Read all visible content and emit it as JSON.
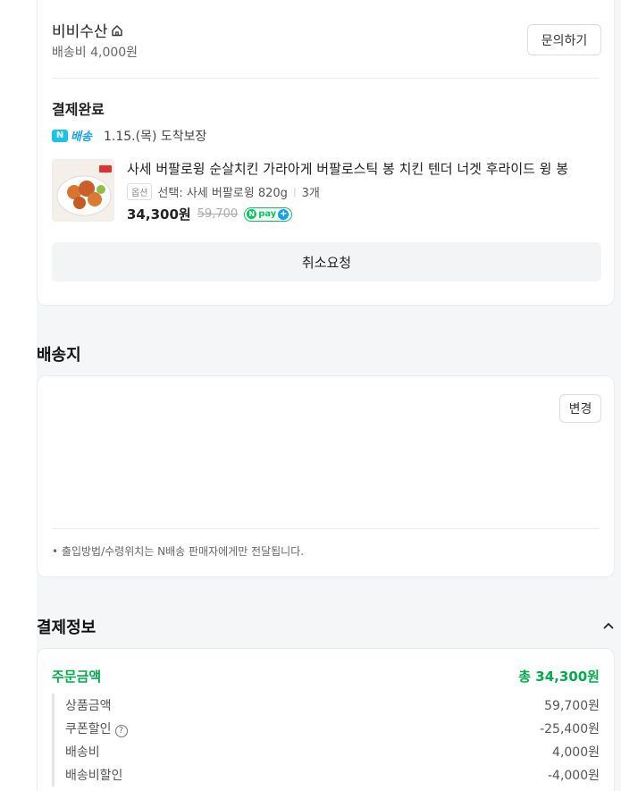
{
  "store": {
    "name": "비비수산",
    "shipping_fee": "배송비 4,000원",
    "inquiry_label": "문의하기"
  },
  "order": {
    "status": "결제완료",
    "delivery_badge": "배송",
    "delivery_badge_n": "N",
    "arrival": "1.15.(목) 도착보장",
    "product_title": "사세 버팔로윙 순살치킨 가라아게 버팔로스틱 봉 치킨 텐더 너겟 후라이드 윙 봉",
    "option_badge": "옵션",
    "option_text": "선택: 사세 버팔로윙 820g",
    "quantity": "3개",
    "price": "34,300원",
    "original_price": "59,700",
    "npay_label": "pay",
    "cancel_label": "취소요청"
  },
  "shipping": {
    "section_title": "배송지",
    "change_label": "변경",
    "notice": "출입방법/수령위치는 N배송 판매자에게만 전달됩니다."
  },
  "payment": {
    "section_title": "결제정보",
    "order_amount_label": "주문금액",
    "order_amount_total": "총 34,300원",
    "rows": [
      {
        "label": "상품금액",
        "value": "59,700원"
      },
      {
        "label": "쿠폰할인",
        "value": "-25,400원"
      },
      {
        "label": "배송비",
        "value": "4,000원"
      },
      {
        "label": "배송비할인",
        "value": "-4,000원"
      }
    ]
  },
  "colors": {
    "accent_green": "#03a94e",
    "npay_green": "#03c75a",
    "nbrand_blue": "#19a0e8"
  }
}
